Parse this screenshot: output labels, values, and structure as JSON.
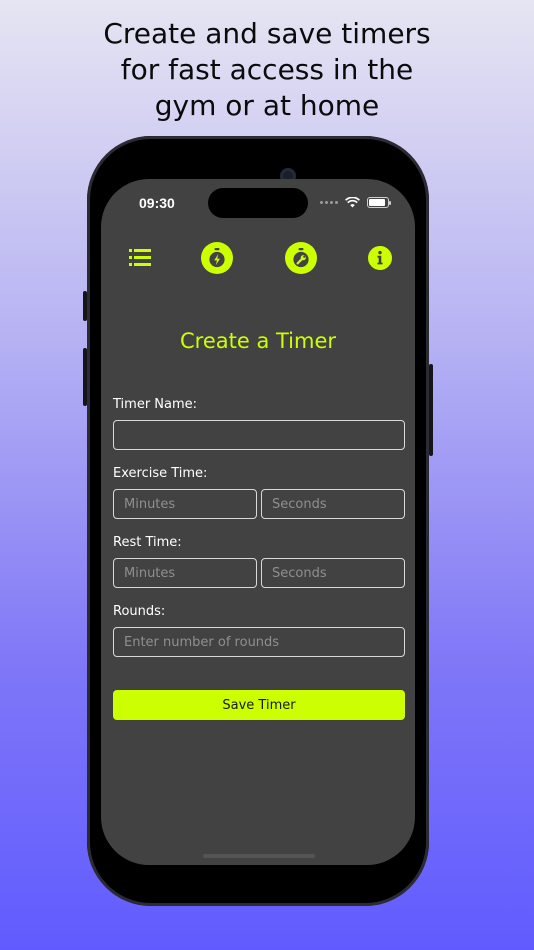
{
  "marketing": {
    "line1": "Create and save timers",
    "line2": "for fast access in the",
    "line3": "gym or at home"
  },
  "status_bar": {
    "time": "09:30"
  },
  "nav": {
    "items": [
      "list-icon",
      "stopwatch-bolt-icon",
      "stopwatch-wrench-icon",
      "info-icon"
    ]
  },
  "page": {
    "title": "Create a Timer"
  },
  "form": {
    "timer_name_label": "Timer Name:",
    "timer_name_value": "",
    "exercise_label": "Exercise Time:",
    "exercise_minutes_placeholder": "Minutes",
    "exercise_seconds_placeholder": "Seconds",
    "rest_label": "Rest Time:",
    "rest_minutes_placeholder": "Minutes",
    "rest_seconds_placeholder": "Seconds",
    "rounds_label": "Rounds:",
    "rounds_placeholder": "Enter number of rounds",
    "save_label": "Save Timer"
  },
  "colors": {
    "accent": "#ccff00",
    "screen_bg": "#424242"
  }
}
